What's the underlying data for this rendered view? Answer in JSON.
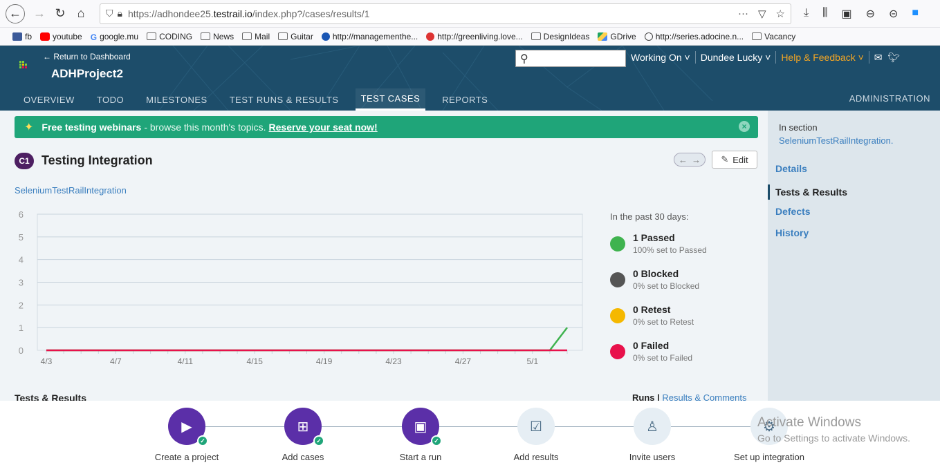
{
  "browser": {
    "url_prefix": "https://adhondee25.",
    "url_domain": "testrail.io",
    "url_path": "/index.php?/cases/results/1",
    "more_icon": "···"
  },
  "bookmarks": [
    {
      "icon": "fb",
      "label": "fb"
    },
    {
      "icon": "yt",
      "label": "youtube"
    },
    {
      "icon": "g",
      "label": "google.mu"
    },
    {
      "icon": "folder",
      "label": "CODING"
    },
    {
      "icon": "folder",
      "label": "News"
    },
    {
      "icon": "folder",
      "label": "Mail"
    },
    {
      "icon": "folder",
      "label": "Guitar"
    },
    {
      "icon": "blue",
      "label": "http://managementhe..."
    },
    {
      "icon": "red",
      "label": "http://greenliving.love..."
    },
    {
      "icon": "folder",
      "label": "DesignIdeas"
    },
    {
      "icon": "drive",
      "label": "GDrive"
    },
    {
      "icon": "globe",
      "label": "http://series.adocine.n..."
    },
    {
      "icon": "folder",
      "label": "Vacancy"
    }
  ],
  "header": {
    "back_link": "← Return to Dashboard",
    "project": "ADHProject2",
    "working_on": "Working On ˅",
    "user": "Dundee Lucky ˅",
    "help": "Help & Feedback ˅",
    "tabs": [
      "OVERVIEW",
      "TODO",
      "MILESTONES",
      "TEST RUNS & RESULTS",
      "TEST CASES",
      "REPORTS"
    ],
    "active_tab": "TEST CASES",
    "admin": "ADMINISTRATION"
  },
  "banner": {
    "bold": "Free testing webinars",
    "text": "- browse this month's topics.",
    "link": "Reserve your seat now!"
  },
  "case": {
    "id": "C1",
    "title": "Testing Integration",
    "edit": "Edit",
    "section": "SeleniumTestRailIntegration"
  },
  "legend": {
    "heading": "In the past 30 days:",
    "items": [
      {
        "main": "1 Passed",
        "sub": "100% set to Passed",
        "color": "#3fb34f"
      },
      {
        "main": "0 Blocked",
        "sub": "0% set to Blocked",
        "color": "#555555"
      },
      {
        "main": "0 Retest",
        "sub": "0% set to Retest",
        "color": "#f5b800"
      },
      {
        "main": "0 Failed",
        "sub": "0% set to Failed",
        "color": "#e8114b"
      }
    ]
  },
  "chart_data": {
    "type": "line",
    "x": [
      "4/3",
      "4/4",
      "4/5",
      "4/6",
      "4/7",
      "4/8",
      "4/9",
      "4/10",
      "4/11",
      "4/12",
      "4/13",
      "4/14",
      "4/15",
      "4/16",
      "4/17",
      "4/18",
      "4/19",
      "4/20",
      "4/21",
      "4/22",
      "4/23",
      "4/24",
      "4/25",
      "4/26",
      "4/27",
      "4/28",
      "4/29",
      "4/30",
      "5/1",
      "5/2",
      "5/3"
    ],
    "tick_labels": [
      "4/3",
      "4/7",
      "4/11",
      "4/15",
      "4/19",
      "4/23",
      "4/27",
      "5/1"
    ],
    "series": [
      {
        "name": "Passed",
        "color": "#3fb34f",
        "values": [
          0,
          0,
          0,
          0,
          0,
          0,
          0,
          0,
          0,
          0,
          0,
          0,
          0,
          0,
          0,
          0,
          0,
          0,
          0,
          0,
          0,
          0,
          0,
          0,
          0,
          0,
          0,
          0,
          0,
          0,
          1
        ]
      },
      {
        "name": "Failed",
        "color": "#e8114b",
        "values": [
          0,
          0,
          0,
          0,
          0,
          0,
          0,
          0,
          0,
          0,
          0,
          0,
          0,
          0,
          0,
          0,
          0,
          0,
          0,
          0,
          0,
          0,
          0,
          0,
          0,
          0,
          0,
          0,
          0,
          0,
          0
        ]
      }
    ],
    "ylim": [
      0,
      6
    ],
    "yticks": [
      0,
      1,
      2,
      3,
      4,
      5,
      6
    ],
    "grid": true
  },
  "sections": {
    "tests_results": "Tests & Results",
    "runs_label": "Runs",
    "runs_sep": " | ",
    "runs_link": "Results & Comments"
  },
  "sidebar": {
    "in_section": "In section",
    "section_link": "SeleniumTestRailIntegration.",
    "items": [
      {
        "label": "Details"
      },
      {
        "label": "Tests & Results"
      },
      {
        "label": "Defects"
      },
      {
        "label": "History"
      }
    ],
    "active": "Tests & Results"
  },
  "onboarding": [
    {
      "label": "Create a project",
      "done": true,
      "icon": "project-icon"
    },
    {
      "label": "Add cases",
      "done": true,
      "icon": "add-cases-icon"
    },
    {
      "label": "Start a run",
      "done": true,
      "icon": "run-icon"
    },
    {
      "label": "Add results",
      "done": false,
      "icon": "results-icon"
    },
    {
      "label": "Invite users",
      "done": false,
      "icon": "invite-icon"
    },
    {
      "label": "Set up integration",
      "done": false,
      "icon": "integration-icon"
    }
  ],
  "watermark": {
    "title": "Activate Windows",
    "sub": "Go to Settings to activate Windows."
  }
}
